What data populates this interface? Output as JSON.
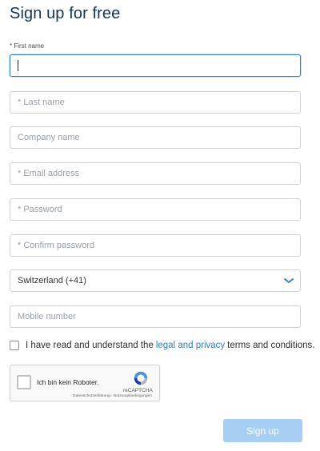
{
  "page": {
    "title": "Sign up for free"
  },
  "form": {
    "first_name_label": "* First name",
    "first_name_value": "",
    "last_name_placeholder": "* Last name",
    "company_placeholder": "Company name",
    "email_placeholder": "* Email address",
    "password_placeholder": "* Password",
    "confirm_password_placeholder": "* Confirm password",
    "country_selected": "Switzerland (+41)",
    "mobile_placeholder": "Mobile number",
    "terms": {
      "before": "I have read and understand the",
      "link": "legal and privacy",
      "after": "terms and conditions."
    }
  },
  "recaptcha": {
    "label": "Ich bin kein Roboter.",
    "brand": "reCAPTCHA",
    "terms": "Datenschutzerklärung - Nutzungsbedingungen"
  },
  "actions": {
    "signup_label": "Sign up"
  },
  "colors": {
    "title": "#13345c",
    "accent": "#2f7dd1",
    "button_disabled": "#a7cff4"
  },
  "icons": {
    "select_chevron": "chevron-down-icon",
    "recaptcha_logo": "recaptcha-logo-icon"
  }
}
